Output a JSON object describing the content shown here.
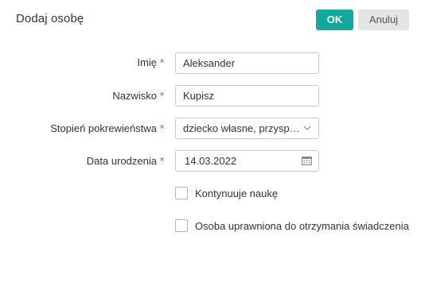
{
  "dialog": {
    "title": "Dodaj osobę",
    "ok_label": "OK",
    "cancel_label": "Anuluj"
  },
  "form": {
    "required_mark": "*",
    "fields": {
      "first_name": {
        "label": "Imię",
        "value": "Aleksander"
      },
      "last_name": {
        "label": "Nazwisko",
        "value": "Kupisz"
      },
      "relationship": {
        "label": "Stopień pokrewieństwa",
        "value": "dziecko własne, przysposobione"
      },
      "birth_date": {
        "label": "Data urodzenia",
        "value": "14.03.2022"
      }
    },
    "checkboxes": {
      "continues_education": {
        "label": "Kontynuuje naukę",
        "checked": false
      },
      "benefit_eligible": {
        "label": "Osoba uprawniona do otrzymania świadczenia",
        "checked": false
      }
    }
  },
  "colors": {
    "primary": "#13a89e",
    "required": "#e53935",
    "border": "#c8c8c8"
  },
  "icons": {
    "dropdown": "chevron-down-icon",
    "date": "calendar-icon"
  }
}
